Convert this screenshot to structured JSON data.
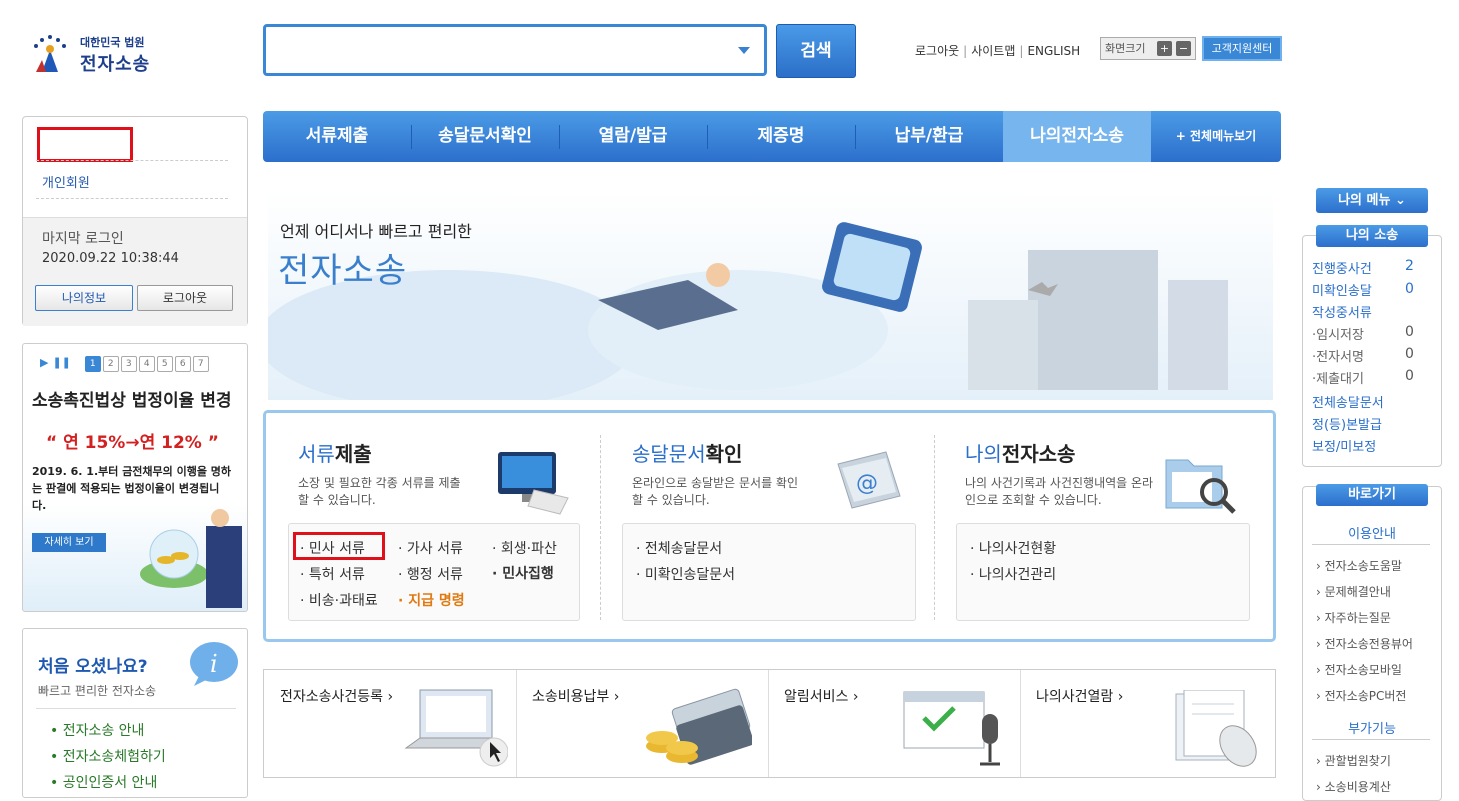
{
  "header": {
    "logo_sub": "대한민국 법원",
    "logo_main": "전자소송",
    "search_button": "검색",
    "links": [
      "로그아웃",
      "사이트맵",
      "ENGLISH"
    ],
    "zoom_label": "화면크기",
    "zoom_plus": "+",
    "zoom_minus": "−",
    "support": "고객지원센터"
  },
  "nav": {
    "items": [
      "서류제출",
      "송달문서확인",
      "열람/발급",
      "제증명",
      "납부/환급",
      "나의전자소송"
    ],
    "all_menu": "+ 전체메뉴보기"
  },
  "login": {
    "member_type": "개인회원",
    "last_login_label": "마지막 로그인",
    "last_login_value": "2020.09.22 10:38:44",
    "my_info": "나의정보",
    "logout": "로그아웃"
  },
  "notice": {
    "pages": [
      "1",
      "2",
      "3",
      "4",
      "5",
      "6",
      "7"
    ],
    "title": "소송촉진법상 법정이율 변경",
    "rate": "“ 연 15%→연 12% ”",
    "body": "2019. 6. 1.부터 금전채무의 이행을 명하는 판결에 적용되는 법정이율이 변경됩니다.",
    "detail": "자세히 보기"
  },
  "first_visit": {
    "title": "처음 오셨나요?",
    "subtitle": "빠르고 편리한 전자소송",
    "links": [
      "• 전자소송 안내",
      "• 전자소송체험하기",
      "• 공인인증서 안내"
    ]
  },
  "banner": {
    "line1": "언제 어디서나 빠르고 편리한",
    "line2": "전자소송"
  },
  "services": {
    "col1": {
      "title_blue": "서류",
      "title_black": "제출",
      "desc": "소장 및 필요한 각종 서류를 제출할 수 있습니다.",
      "links": [
        "· 민사 서류",
        "· 가사 서류",
        "· 회생·파산",
        "· 특허 서류",
        "· 행정 서류",
        "· 민사집행",
        "· 비송·과태료",
        "· 지급 명령"
      ]
    },
    "col2": {
      "title_blue": "송달문서",
      "title_black": "확인",
      "desc": "온라인으로 송달받은 문서를 확인 할 수 있습니다.",
      "links": [
        "· 전체송달문서",
        "· 미확인송달문서"
      ]
    },
    "col3": {
      "title_blue": "나의",
      "title_black": "전자소송",
      "desc": "나의 사건기록과 사건진행내역을 온라인으로 조회할 수 있습니다.",
      "links": [
        "· 나의사건현황",
        "· 나의사건관리"
      ]
    }
  },
  "quick": [
    "전자소송사건등록 ›",
    "소송비용납부 ›",
    "알림서비스 ›",
    "나의사건열람 ›"
  ],
  "right": {
    "my_menu": "나의 메뉴 ⌄",
    "my_suit": "나의 소송",
    "rows": [
      {
        "label": "진행중사건",
        "value": "2"
      },
      {
        "label": "미확인송달",
        "value": "0"
      },
      {
        "label": "작성중서류",
        "value": ""
      },
      {
        "label": "·임시저장",
        "value": "0"
      },
      {
        "label": "·전자서명",
        "value": "0"
      },
      {
        "label": "·제출대기",
        "value": "0"
      },
      {
        "label": "전체송달문서",
        "value": ""
      },
      {
        "label": "정(등)본발급",
        "value": ""
      },
      {
        "label": "보정/미보정",
        "value": ""
      }
    ],
    "goto": "바로가기",
    "section1": "이용안내",
    "items1": [
      "› 전자소송도움말",
      "› 문제해결안내",
      "› 자주하는질문",
      "› 전자소송전용뷰어",
      "› 전자소송모바일",
      "› 전자소송PC버전"
    ],
    "section2": "부가기능",
    "items2": [
      "› 관할법원찾기",
      "› 소송비용계산"
    ]
  }
}
